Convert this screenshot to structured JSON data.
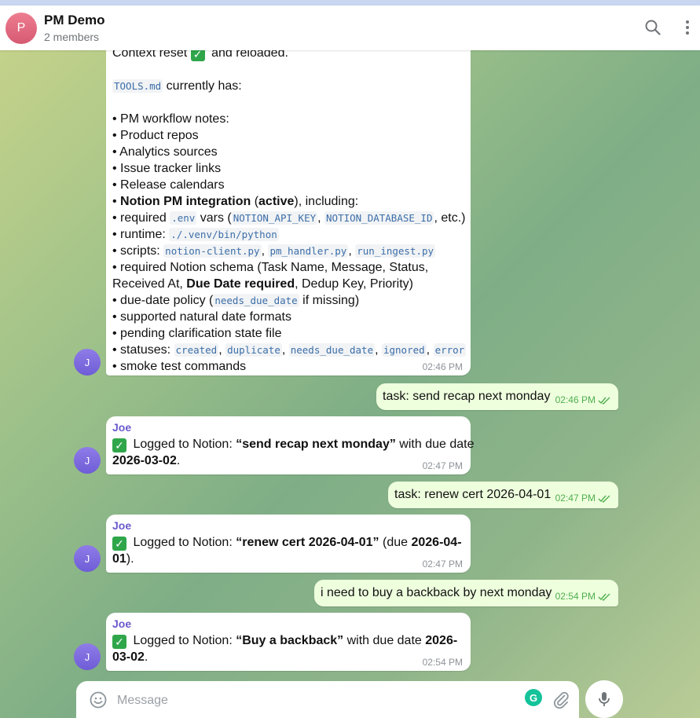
{
  "header": {
    "avatar_letter": "P",
    "title": "PM Demo",
    "subtitle": "2 members"
  },
  "messages": {
    "m1": {
      "intro_a": "Context reset",
      "intro_b": "and reloaded.",
      "tools_code": "TOOLS.md",
      "tools_text": "currently has:",
      "b1": "• PM workflow notes:",
      "b2": "• Product repos",
      "b3": "• Analytics sources",
      "b4": "• Issue tracker links",
      "b5": "• Release calendars",
      "b6_bullet": "• ",
      "b6_bold": "Notion PM integration",
      "b6_mid": " (",
      "b6_bold2": "active",
      "b6_end": "), including:",
      "b7_a": "• required ",
      "b7_code1": ".env",
      "b7_b": " vars (",
      "b7_code2": "NOTION_API_KEY",
      "b7_c": ", ",
      "b7_code3": "NOTION_DATABASE_ID",
      "b7_d": ", etc.)",
      "b8_a": "• runtime: ",
      "b8_code": "./.venv/bin/python",
      "b9_a": "• scripts: ",
      "b9_code1": "notion-client.py",
      "b9_sep1": ", ",
      "b9_code2": "pm_handler.py",
      "b9_sep2": ", ",
      "b9_code3": "run_ingest.py",
      "b10_a": "• required Notion schema (Task Name, Message, Status,",
      "b10_b": "Received At, ",
      "b10_bold": "Due Date required",
      "b10_c": ", Dedup Key, Priority)",
      "b11_a": "• due-date policy (",
      "b11_code": "needs_due_date",
      "b11_b": " if missing)",
      "b12": "• supported natural date formats",
      "b13": "• pending clarification state file",
      "b14_a": "• statuses: ",
      "b14_c1": "created",
      "b14_s1": ", ",
      "b14_c2": "duplicate",
      "b14_s2": ", ",
      "b14_c3": "needs_due_date",
      "b14_s3": ", ",
      "b14_c4": "ignored",
      "b14_s4": ", ",
      "b14_c5": "error",
      "b15": "• smoke test commands",
      "time": "02:46 PM"
    },
    "o1": {
      "text": "task: send recap next monday",
      "time": "02:46 PM"
    },
    "m2": {
      "sender": "Joe",
      "a": " Logged to Notion: ",
      "bold1": "“send recap next monday”",
      "b": " with due date",
      "bold2": "2026-03-02",
      "c": ".",
      "time": "02:47 PM"
    },
    "o2": {
      "text": "task: renew cert 2026-04-01",
      "time": "02:47 PM"
    },
    "m3": {
      "sender": "Joe",
      "a": " Logged to Notion: ",
      "bold1": "“renew cert 2026-04-01”",
      "b": " (due ",
      "bold2": "2026-04-",
      "bold3": "01",
      "c": ").",
      "time": "02:47 PM"
    },
    "o3": {
      "text": "i need to buy a backback by next monday",
      "time": "02:54 PM"
    },
    "m4": {
      "sender": "Joe",
      "a": " Logged to Notion: ",
      "bold1": "“Buy a backback”",
      "b": " with due date ",
      "bold2": "2026-",
      "bold3": "03-02",
      "c": ".",
      "time": "02:54 PM"
    }
  },
  "avatar_letter": "J",
  "composer": {
    "placeholder": "Message",
    "grammarly_letter": "G"
  },
  "icons": {
    "search": "search-icon",
    "more": "more-vertical-icon",
    "emoji": "emoji-icon",
    "attach": "paperclip-icon",
    "mic": "microphone-icon",
    "check": "check-mark-icon",
    "read": "double-check-icon"
  },
  "colors": {
    "accent": "#6a5acd",
    "outgoing_bubble": "#eeffde",
    "read_ticks": "#4fae4e",
    "header_avatar": "#e06b80"
  }
}
